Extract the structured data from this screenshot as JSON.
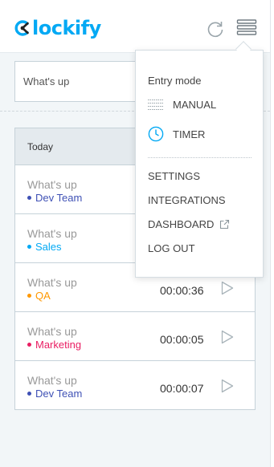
{
  "header": {
    "logo_text": "lockify",
    "colors": {
      "brand": "#03a9f4"
    }
  },
  "timer": {
    "description_placeholder": "What's up"
  },
  "entries": {
    "group_label": "Today",
    "items": [
      {
        "description": "What's up",
        "project": "Dev Team",
        "project_color": "#3f51b5",
        "duration": ""
      },
      {
        "description": "What's up",
        "project": "Sales",
        "project_color": "#03a9f4",
        "duration": ""
      },
      {
        "description": "What's up",
        "project": "QA",
        "project_color": "#ff9800",
        "duration": "00:00:36"
      },
      {
        "description": "What's up",
        "project": "Marketing",
        "project_color": "#e91e63",
        "duration": "00:00:05"
      },
      {
        "description": "What's up",
        "project": "Dev Team",
        "project_color": "#3f51b5",
        "duration": "00:00:07"
      }
    ]
  },
  "menu": {
    "entry_mode_label": "Entry mode",
    "manual_label": "MANUAL",
    "timer_label": "TIMER",
    "settings_label": "SETTINGS",
    "integrations_label": "INTEGRATIONS",
    "dashboard_label": "DASHBOARD",
    "logout_label": "LOG OUT",
    "icons": [
      "list-icon",
      "clock-icon",
      "external-link-icon",
      "refresh-icon",
      "hamburger-menu-icon",
      "play-icon"
    ]
  }
}
